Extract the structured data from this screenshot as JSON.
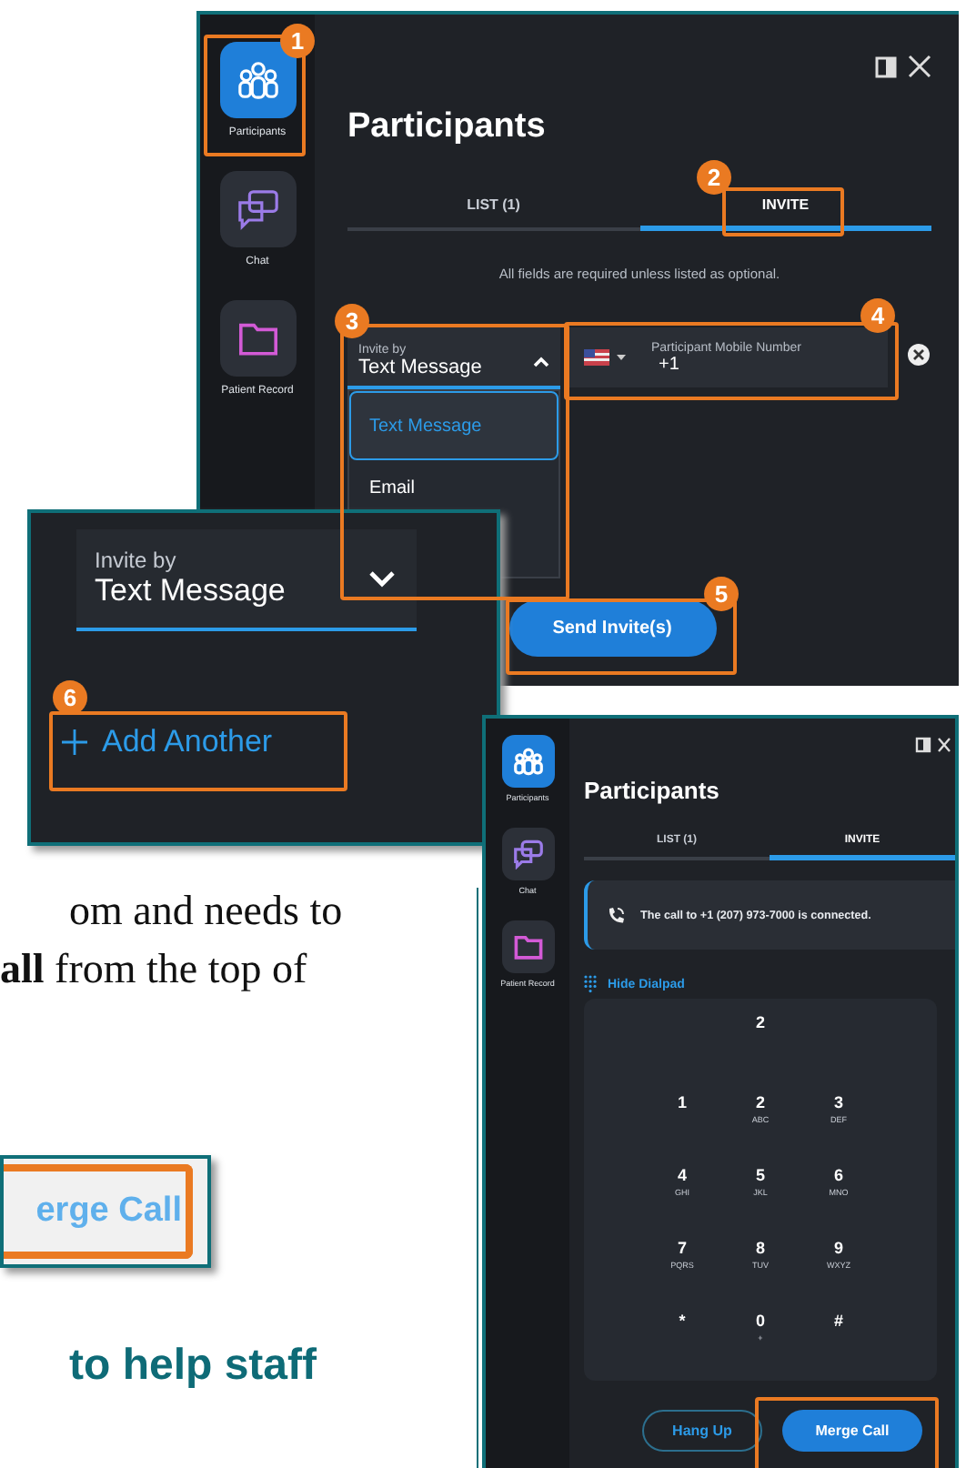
{
  "invite_panel": {
    "rail": [
      {
        "label": "Participants",
        "selected": true
      },
      {
        "label": "Chat",
        "selected": false
      },
      {
        "label": "Patient Record",
        "selected": false
      }
    ],
    "title": "Participants",
    "tabs": [
      {
        "label": "LIST (1)",
        "selected": false
      },
      {
        "label": "INVITE",
        "selected": true
      }
    ],
    "hint": "All fields are required unless listed as optional.",
    "invite_by": {
      "label": "Invite by",
      "value": "Text Message",
      "expanded": true
    },
    "options": [
      {
        "label": "Text Message",
        "selected": true
      },
      {
        "label": "Email",
        "selected": false
      }
    ],
    "phone_field": {
      "placeholder": "Participant Mobile Number",
      "value": "+1"
    },
    "send_button": "Send Invite(s)"
  },
  "add_panel": {
    "invite_by": {
      "label": "Invite by",
      "value": "Text Message",
      "expanded": false
    },
    "add_button": "Add Another"
  },
  "document": {
    "lines": [
      "om and needs to",
      "**all** from the top of"
    ],
    "button_snippet": "erge Call",
    "heading": "to help staff"
  },
  "dialpad_panel": {
    "rail": [
      {
        "label": "Participants",
        "selected": true
      },
      {
        "label": "Chat",
        "selected": false
      },
      {
        "label": "Patient Record",
        "selected": false
      }
    ],
    "title": "Participants",
    "tabs": [
      {
        "label": "LIST (1)",
        "selected": false
      },
      {
        "label": "INVITE",
        "selected": true
      }
    ],
    "notice": "The call to +1 (207) 973-7000 is connected.",
    "dialpad_toggle": "Hide Dialpad",
    "display": "2",
    "keys": [
      {
        "digit": "1"
      },
      {
        "digit": "2",
        "letters": "ABC"
      },
      {
        "digit": "3",
        "letters": "DEF"
      },
      {
        "digit": "4",
        "letters": "GHI"
      },
      {
        "digit": "5",
        "letters": "JKL"
      },
      {
        "digit": "6",
        "letters": "MNO"
      },
      {
        "digit": "7",
        "letters": "PQRS"
      },
      {
        "digit": "8",
        "letters": "TUV"
      },
      {
        "digit": "9",
        "letters": "WXYZ"
      },
      {
        "digit": "*"
      },
      {
        "digit": "0",
        "letters": "+"
      },
      {
        "digit": "#"
      }
    ],
    "hang_up_button": "Hang Up",
    "merge_button": "Merge Call"
  },
  "callouts": [
    "1",
    "2",
    "3",
    "4",
    "5",
    "6"
  ]
}
